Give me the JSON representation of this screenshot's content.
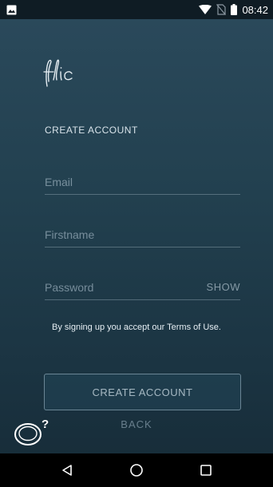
{
  "status_bar": {
    "time": "08:42",
    "icons": [
      "image-icon",
      "wifi-icon",
      "no-sim-icon",
      "battery-icon"
    ]
  },
  "logo": {
    "text": "flic"
  },
  "form": {
    "title": "CREATE ACCOUNT",
    "email_label": "Email",
    "firstname_label": "Firstname",
    "password_label": "Password",
    "show_label": "SHOW"
  },
  "terms_text": "By signing up you accept our Terms of Use.",
  "buttons": {
    "create_label": "CREATE ACCOUNT",
    "back_label": "BACK"
  },
  "help": {
    "mark": "?"
  },
  "nav_bar": {
    "icons": [
      "back-icon",
      "home-icon",
      "recents-icon"
    ]
  },
  "colors": {
    "background_top": "#2b4a5c",
    "background_bottom": "#162b37",
    "status_bar": "#0f1c24",
    "nav_bar": "#000000",
    "text": "#d8e3ea"
  }
}
